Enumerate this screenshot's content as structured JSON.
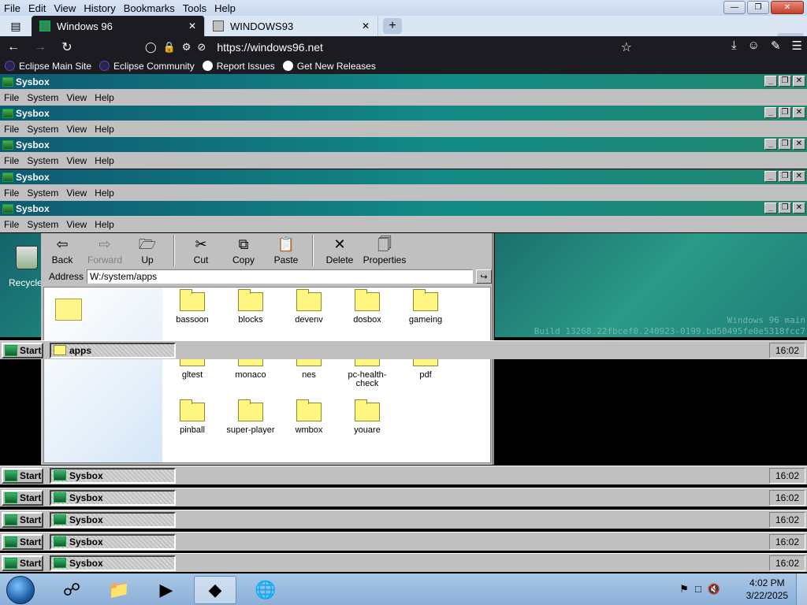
{
  "browser": {
    "menu": [
      "File",
      "Edit",
      "View",
      "History",
      "Bookmarks",
      "Tools",
      "Help"
    ],
    "tabs": [
      {
        "title": "Windows 96",
        "active": true
      },
      {
        "title": "WINDOWS93",
        "active": false
      }
    ],
    "tab_count": "2",
    "url": "https://windows96.net",
    "bookmarks": [
      {
        "label": "Eclipse Main Site",
        "icon": "eclipse-icon"
      },
      {
        "label": "Eclipse Community",
        "icon": "eclipse-icon"
      },
      {
        "label": "Report Issues",
        "icon": "github-icon"
      },
      {
        "label": "Get New Releases",
        "icon": "github-icon"
      }
    ]
  },
  "sysbox": {
    "title": "Sysbox",
    "menu": [
      "File",
      "System",
      "View",
      "Help"
    ]
  },
  "explorer": {
    "toolbar": [
      {
        "label": "Back",
        "icon": "back-arrow-icon",
        "enabled": true
      },
      {
        "label": "Forward",
        "icon": "forward-arrow-icon",
        "enabled": false
      },
      {
        "label": "Up",
        "icon": "up-folder-icon",
        "enabled": true
      },
      {
        "label": "Cut",
        "icon": "scissors-icon",
        "enabled": true
      },
      {
        "label": "Copy",
        "icon": "copy-icon",
        "enabled": true
      },
      {
        "label": "Paste",
        "icon": "paste-icon",
        "enabled": true
      },
      {
        "label": "Delete",
        "icon": "delete-x-icon",
        "enabled": true
      },
      {
        "label": "Properties",
        "icon": "properties-icon",
        "enabled": true
      }
    ],
    "address_label": "Address",
    "address": "W:/system/apps",
    "folders_row1": [
      "bassoon",
      "blocks",
      "devenv",
      "dosbox",
      "gameing"
    ],
    "folders_row2": [
      "gltest",
      "monaco",
      "nes",
      "pc-health-check",
      "pdf"
    ],
    "folders_row3": [
      "pinball",
      "super-player",
      "wmbox",
      "youare"
    ]
  },
  "desktop": {
    "recycle_label": "Recycle",
    "version_line1": "Windows 96 main",
    "version_line2": "Build 13268.22fbcef0.240923-0199.bd50495fe0e5318fcc7"
  },
  "taskbars": [
    {
      "start": "Start",
      "item": "apps",
      "clock": "16:02"
    },
    {
      "start": "Start",
      "item": "Sysbox",
      "clock": "16:02"
    },
    {
      "start": "Start",
      "item": "Sysbox",
      "clock": "16:02"
    },
    {
      "start": "Start",
      "item": "Sysbox",
      "clock": "16:02"
    },
    {
      "start": "Start",
      "item": "Sysbox",
      "clock": "16:02"
    },
    {
      "start": "Start",
      "item": "Sysbox",
      "clock": "16:02"
    }
  ],
  "win7": {
    "time": "4:02 PM",
    "date": "3/22/2025"
  }
}
